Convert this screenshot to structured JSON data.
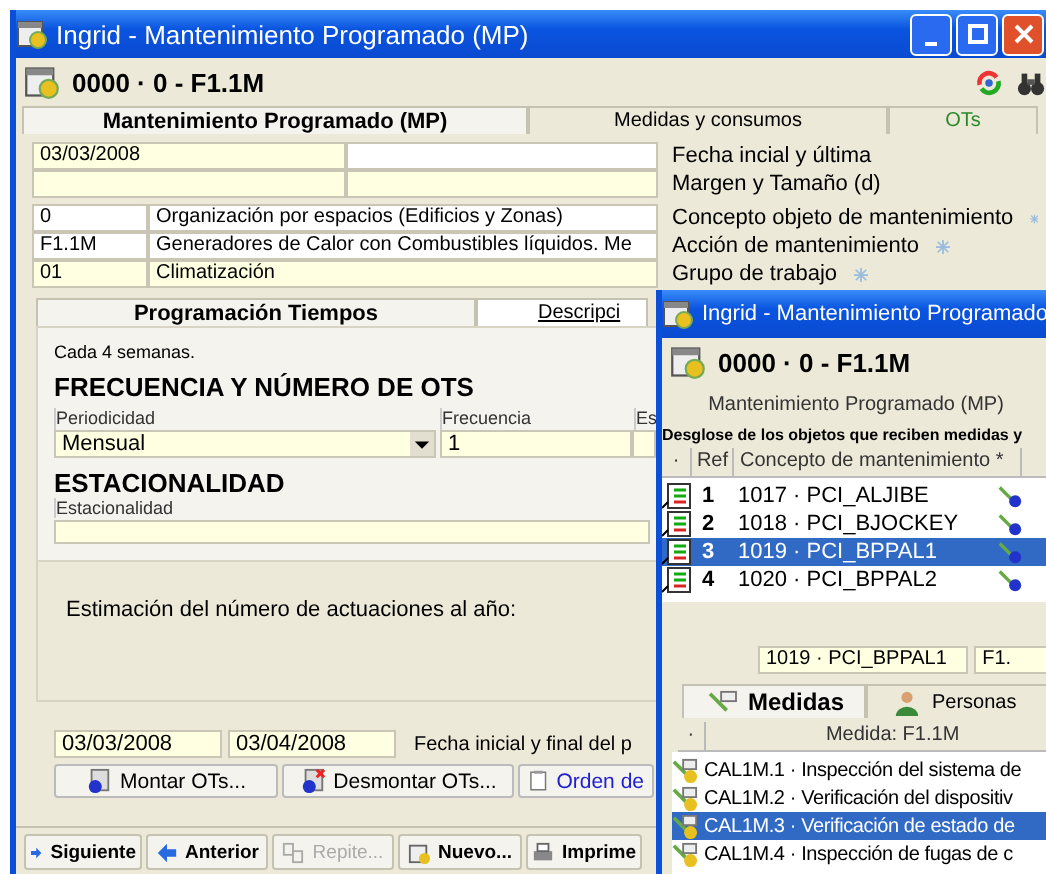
{
  "main_window": {
    "title": "Ingrid - Mantenimiento Programado (MP)",
    "record": "0000 · 0 - F1.1M",
    "tabs": [
      {
        "label": "Mantenimiento Programado (MP)",
        "selected": true
      },
      {
        "label": "Medidas y consumos",
        "selected": false
      },
      {
        "label": "OTs",
        "selected": false
      }
    ],
    "field_rows": [
      {
        "values": [
          {
            "text": "03/03/2008",
            "kind": "yellow"
          },
          {
            "kind": "white"
          }
        ],
        "label": "Fecha incial y última",
        "lookup": false
      },
      {
        "values": [
          {
            "kind": "yellow"
          },
          {
            "kind": "yellow"
          }
        ],
        "label": "Margen y Tamaño (d)",
        "lookup": false
      },
      {
        "values": [
          {
            "text": "0",
            "kind": "white"
          },
          {
            "text": "Organización por espacios (Edificios y Zonas)",
            "kind": "white"
          }
        ],
        "label": "Concepto objeto de mantenimiento",
        "lookup": true
      },
      {
        "values": [
          {
            "text": "F1.1M",
            "kind": "white"
          },
          {
            "text": "Generadores de Calor con Combustibles líquidos. Me",
            "kind": "white"
          }
        ],
        "label": "Acción de mantenimiento",
        "lookup": true
      },
      {
        "values": [
          {
            "text": "01",
            "kind": "yellow"
          },
          {
            "text": "Climatización",
            "kind": "yellow"
          }
        ],
        "label": "Grupo de trabajo",
        "lookup": true
      }
    ],
    "subtabs": [
      {
        "label": "Programación Tiempos",
        "selected": true
      },
      {
        "label": "Descripci",
        "selected": false
      }
    ],
    "summary": "Cada 4 semanas.",
    "frequency_heading": "FRECUENCIA Y NÚMERO DE OTS",
    "frequency_columns": [
      "Periodicidad",
      "Frecuencia",
      "Es"
    ],
    "periodicity": "Mensual",
    "frequency": "1",
    "seasonality_heading": "ESTACIONALIDAD",
    "seasonality_column": "Estacionalidad",
    "estimate_label": "Estimación del número de actuaciones al año:",
    "start_date": "03/03/2008",
    "end_date": "03/04/2008",
    "dates_label": "Fecha inicial y final del p",
    "actions": [
      {
        "label": "Montar OTs...",
        "kind": "mount"
      },
      {
        "label": "Desmontar OTs...",
        "kind": "unmount"
      },
      {
        "label": "Orden de",
        "kind": "order"
      }
    ],
    "toolbar": [
      {
        "label": "Siguiente",
        "kind": "next",
        "disabled": false
      },
      {
        "label": "Anterior",
        "kind": "prev",
        "disabled": false
      },
      {
        "label": "Repite...",
        "kind": "repeat",
        "disabled": true
      },
      {
        "label": "Nuevo...",
        "kind": "new",
        "disabled": false
      },
      {
        "label": "Imprime",
        "kind": "print",
        "disabled": false
      }
    ]
  },
  "second_window": {
    "title": "Ingrid - Mantenimiento Programado",
    "record": "0000 · 0 - F1.1M",
    "caption": "Mantenimiento Programado (MP)",
    "breakdown_title": "Desglose de los objetos que reciben medidas y",
    "columns": [
      "·",
      "Ref",
      "Concepto de mantenimiento *"
    ],
    "rows": [
      {
        "ref": "1",
        "concept": "1017 · PCI_ALJIBE",
        "selected": false
      },
      {
        "ref": "2",
        "concept": "1018 · PCI_BJOCKEY",
        "selected": false
      },
      {
        "ref": "3",
        "concept": "1019 · PCI_BPPAL1",
        "selected": true
      },
      {
        "ref": "4",
        "concept": "1020 · PCI_BPPAL2",
        "selected": false
      }
    ],
    "current": "1019 · PCI_BPPAL1",
    "current_code": "F1.",
    "tabs": [
      {
        "label": "Medidas",
        "kind": "measures",
        "selected": true
      },
      {
        "label": "Personas",
        "kind": "people",
        "selected": false
      }
    ],
    "measures_columns": [
      "·",
      "Medida: F1.1M"
    ],
    "measures": [
      {
        "text": "CAL1M.1 · Inspección del sistema de",
        "selected": false
      },
      {
        "text": "CAL1M.2 · Verificación del dispositiv",
        "selected": false
      },
      {
        "text": "CAL1M.3 · Verificación de estado de",
        "selected": true
      },
      {
        "text": "CAL1M.4 · Inspección de fugas de c",
        "selected": false
      }
    ]
  }
}
